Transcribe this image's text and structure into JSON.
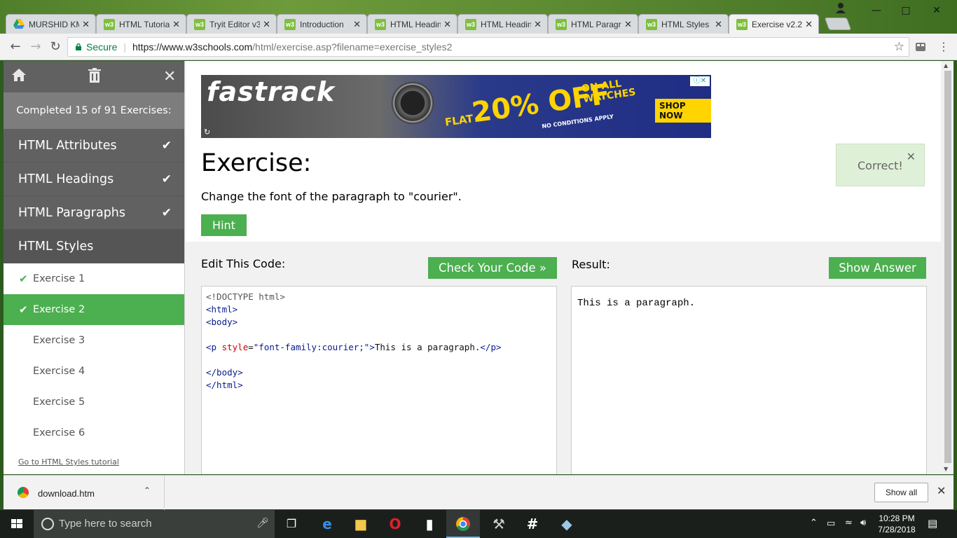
{
  "browser": {
    "tabs": [
      {
        "label": "MURSHID KM",
        "icon": "google-drive-icon"
      },
      {
        "label": "HTML Tutorial",
        "icon": "w3schools-icon"
      },
      {
        "label": "Tryit Editor v3",
        "icon": "w3schools-icon"
      },
      {
        "label": "Introduction",
        "icon": "w3schools-icon"
      },
      {
        "label": "HTML Heading",
        "icon": "w3schools-icon"
      },
      {
        "label": "HTML Heading",
        "icon": "w3schools-icon"
      },
      {
        "label": "HTML Paragraph",
        "icon": "w3schools-icon"
      },
      {
        "label": "HTML Styles",
        "icon": "w3schools-icon"
      },
      {
        "label": "Exercise v2.2",
        "icon": "w3schools-icon",
        "active": true
      }
    ],
    "secure_label": "Secure",
    "url_host": "https://www.w3schools.com",
    "url_path": "/html/exercise.asp?filename=exercise_styles2"
  },
  "sidebar": {
    "progress": "Completed 15 of 91 Exercises:",
    "chapters": [
      {
        "label": "HTML Attributes",
        "done": true
      },
      {
        "label": "HTML Headings",
        "done": true
      },
      {
        "label": "HTML Paragraphs",
        "done": true
      },
      {
        "label": "HTML Styles",
        "done": false
      }
    ],
    "exercises": [
      {
        "label": "Exercise 1",
        "done": true
      },
      {
        "label": "Exercise 2",
        "done": true
      },
      {
        "label": "Exercise 3",
        "done": false
      },
      {
        "label": "Exercise 4",
        "done": false
      },
      {
        "label": "Exercise 5",
        "done": false
      },
      {
        "label": "Exercise 6",
        "done": false
      }
    ],
    "tutorial_link": "Go to HTML Styles tutorial"
  },
  "ad": {
    "brand": "fastrack",
    "flat": "FLAT",
    "offer": "20% OFF",
    "on_all": "ON ALL",
    "watches": "WATCHES",
    "no_conditions": "NO CONDITIONS APPLY",
    "shop_now": "SHOP NOW"
  },
  "exercise": {
    "title": "Exercise:",
    "description": "Change the font of the paragraph to \"courier\".",
    "hint_label": "Hint",
    "feedback": "Correct!",
    "edit_label": "Edit This Code:",
    "check_label": "Check Your Code »",
    "result_label": "Result:",
    "answer_label": "Show Answer",
    "code": {
      "doctype": "<!DOCTYPE html>",
      "html_open": "<html>",
      "body_open": "<body>",
      "p_open": "<p",
      "attr_name": "style",
      "attr_eq": "=",
      "attr_value": "\"font-family:courier;\"",
      "p_gt": ">",
      "p_text": "This is a paragraph.",
      "p_close": "</p>",
      "body_close": "</body>",
      "html_close": "</html>"
    },
    "result_text": "This is a paragraph."
  },
  "downloads": {
    "file": "download.htm",
    "show_all": "Show all"
  },
  "taskbar": {
    "search_placeholder": "Type here to search",
    "time": "10:28 PM",
    "date": "7/28/2018"
  }
}
